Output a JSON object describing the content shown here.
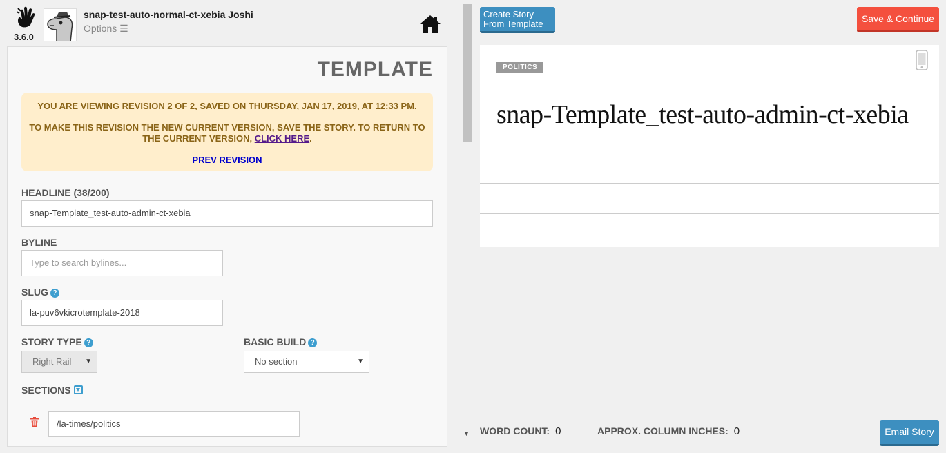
{
  "header": {
    "version": "3.6.0",
    "story_title": "snap-test-auto-normal-ct-xebia Joshi",
    "options_label": "Options ☰"
  },
  "form": {
    "panel_title": "TEMPLATE",
    "revision": {
      "notice": "YOU ARE VIEWING REVISION 2 OF 2, SAVED ON THURSDAY, JAN 17, 2019, AT 12:33 PM.",
      "instruction": "TO MAKE THIS REVISION THE NEW CURRENT VERSION, SAVE THE STORY. TO RETURN TO THE CURRENT VERSION,",
      "click_here": "CLICK HERE",
      "period": ".",
      "prev_revision": "PREV REVISION"
    },
    "headline": {
      "label": "HEADLINE (38/200)",
      "value": "snap-Template_test-auto-admin-ct-xebia"
    },
    "byline": {
      "label": "BYLINE",
      "placeholder": "Type to search bylines..."
    },
    "slug": {
      "label": "SLUG",
      "value": "la-puv6vkicrotemplate-2018"
    },
    "story_type": {
      "label": "STORY TYPE",
      "value": "Right Rail"
    },
    "basic_build": {
      "label": "BASIC BUILD",
      "value": "No section"
    },
    "sections": {
      "label": "SECTIONS",
      "items": [
        "/la-times/politics"
      ]
    }
  },
  "toolbar": {
    "create_from_template": "Create Story From Template",
    "save_continue": "Save & Continue",
    "email_story": "Email Story"
  },
  "preview": {
    "tag": "POLITICS",
    "headline": "snap-Template_test-auto-admin-ct-xebia"
  },
  "footer": {
    "word_count_label": "WORD COUNT:",
    "word_count": "0",
    "column_inches_label": "APPROX. COLUMN INCHES:",
    "column_inches": "0"
  },
  "colors": {
    "accent_blue": "#3d8fc0",
    "save_red": "#f4503e",
    "revision_bg": "#ffeecc",
    "revision_text": "#8a6417"
  },
  "icons": [
    "hand-logo-icon",
    "dinosaur-avatar",
    "home-icon",
    "help-icon",
    "chevron-down-icon",
    "trash-icon",
    "mobile-phone-icon"
  ]
}
